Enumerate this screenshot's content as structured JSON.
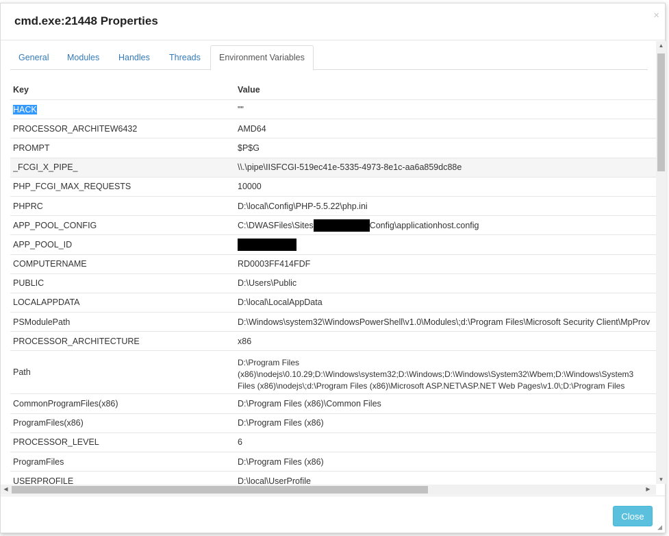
{
  "dialog": {
    "title": "cmd.exe:21448 Properties",
    "close_icon": "×"
  },
  "tabs": [
    {
      "label": "General"
    },
    {
      "label": "Modules"
    },
    {
      "label": "Handles"
    },
    {
      "label": "Threads"
    },
    {
      "label": "Environment Variables"
    }
  ],
  "table": {
    "headers": {
      "key": "Key",
      "value": "Value"
    },
    "rows": [
      {
        "key": "HACK",
        "value": "\"\""
      },
      {
        "key": "PROCESSOR_ARCHITEW6432",
        "value": "AMD64"
      },
      {
        "key": "PROMPT",
        "value": "$P$G"
      },
      {
        "key": "_FCGI_X_PIPE_",
        "value": "\\\\.\\pipe\\IISFCGI-519ec41e-5335-4973-8e1c-aa6a859dc88e"
      },
      {
        "key": "PHP_FCGI_MAX_REQUESTS",
        "value": "10000"
      },
      {
        "key": "PHPRC",
        "value": "D:\\local\\Config\\PHP-5.5.22\\php.ini"
      },
      {
        "key": "APP_POOL_CONFIG",
        "value_prefix": "C:\\DWASFiles\\Sites",
        "value_suffix": "Config\\applicationhost.config"
      },
      {
        "key": "APP_POOL_ID",
        "value": ""
      },
      {
        "key": "COMPUTERNAME",
        "value": "RD0003FF414FDF"
      },
      {
        "key": "PUBLIC",
        "value": "D:\\Users\\Public"
      },
      {
        "key": "LOCALAPPDATA",
        "value": "D:\\local\\LocalAppData"
      },
      {
        "key": "PSModulePath",
        "value": "D:\\Windows\\system32\\WindowsPowerShell\\v1.0\\Modules\\;d:\\Program Files\\Microsoft Security Client\\MpProv"
      },
      {
        "key": "PROCESSOR_ARCHITECTURE",
        "value": "x86"
      },
      {
        "key": "Path",
        "value_lines": [
          "D:\\Program Files",
          "(x86)\\nodejs\\0.10.29;D:\\Windows\\system32;D:\\Windows;D:\\Windows\\System32\\Wbem;D:\\Windows\\System3",
          "Files (x86)\\nodejs\\;d:\\Program Files (x86)\\Microsoft ASP.NET\\ASP.NET Web Pages\\v1.0\\;D:\\Program Files"
        ]
      },
      {
        "key": "CommonProgramFiles(x86)",
        "value": "D:\\Program Files (x86)\\Common Files"
      },
      {
        "key": "ProgramFiles(x86)",
        "value": "D:\\Program Files (x86)"
      },
      {
        "key": "PROCESSOR_LEVEL",
        "value": "6"
      },
      {
        "key": "ProgramFiles",
        "value": "D:\\Program Files (x86)"
      },
      {
        "key": "USERPROFILE",
        "value": "D:\\local\\UserProfile"
      }
    ]
  },
  "footer": {
    "close_label": "Close"
  },
  "colors": {
    "link": "#337ab7",
    "selection": "#3399ff",
    "button": "#5bc0de"
  }
}
